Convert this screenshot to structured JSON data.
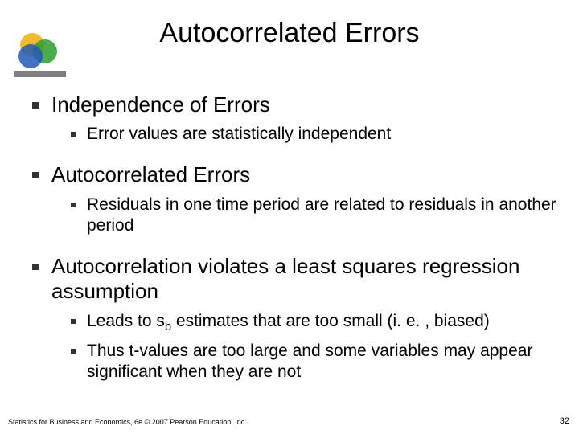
{
  "title": "Autocorrelated Errors",
  "bullets": {
    "b1": "Independence of Errors",
    "b1_1": "Error values are statistically independent",
    "b2": "Autocorrelated Errors",
    "b2_1": "Residuals in one time period are related to residuals in another period",
    "b3": "Autocorrelation violates a least squares regression assumption",
    "b3_1_pre": "Leads to  s",
    "b3_1_sub": "b",
    "b3_1_post": "  estimates that are too small (i. e. , biased)",
    "b3_2": "Thus t-values are too large and some variables may appear significant when they are not"
  },
  "footer": {
    "left": "Statistics for Business and Economics, 6e © 2007 Pearson Education, Inc.",
    "right": "32"
  },
  "logo": {
    "colors": {
      "yellow": "#f0b000",
      "green": "#2a9d2a",
      "blue": "#1e5bb8"
    }
  }
}
